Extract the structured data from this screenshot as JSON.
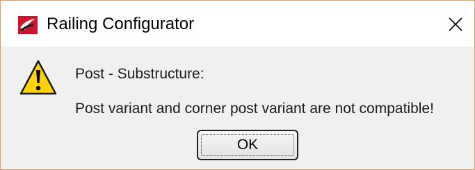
{
  "window": {
    "title": "Railing Configurator",
    "app_icon": "railing-configurator-logo",
    "close_icon": "close-x"
  },
  "message": {
    "icon": "warning-triangle",
    "heading": "Post - Substructure:",
    "body": "Post variant and corner post variant are not compatible!"
  },
  "buttons": {
    "ok_label": "OK"
  },
  "colors": {
    "titlebar_bg": "#ffffff",
    "content_bg": "#f0f0f0",
    "warning_fill": "#ffd200",
    "logo_red": "#c8102e"
  }
}
